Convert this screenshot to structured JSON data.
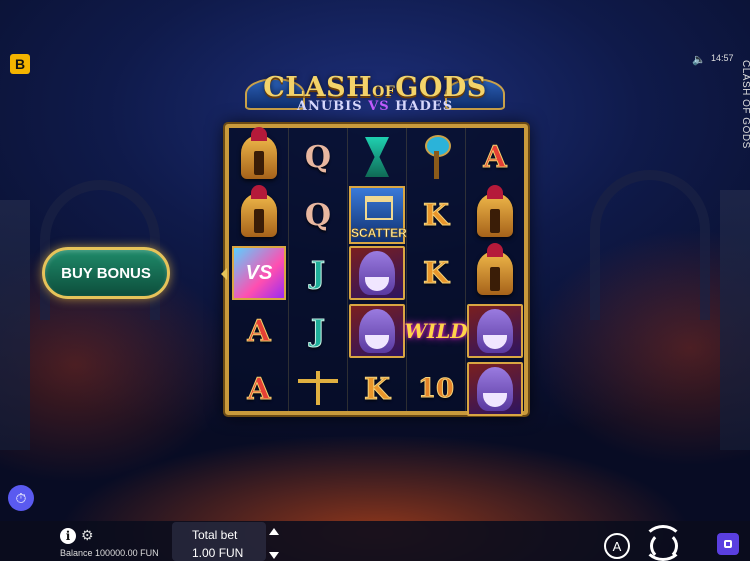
{
  "brand": {
    "badge_letter": "B"
  },
  "status": {
    "time": "14:57",
    "vertical_title": "CLASH OF GODS"
  },
  "logo": {
    "main_a": "CLASH",
    "main_of": "OF",
    "main_b": "GODS",
    "sub_a": "ANUBIS",
    "sub_vs": "VS",
    "sub_b": "HADES"
  },
  "reels": {
    "grid": [
      [
        "helmet",
        "Q",
        "hourglass",
        "axe",
        "A"
      ],
      [
        "helmet",
        "Q",
        "scatter",
        "K",
        "helmet"
      ],
      [
        "vs",
        "J",
        "hades",
        "K",
        "helmet"
      ],
      [
        "A",
        "J",
        "hades",
        "wild",
        "hades"
      ],
      [
        "A",
        "scales",
        "K",
        "10",
        "hades"
      ]
    ],
    "symbol_labels": {
      "scatter": "SCATTER",
      "wild": "WILD",
      "vs": "VS"
    }
  },
  "controls": {
    "buy_bonus": "BUY BONUS",
    "balance_label": "Balance",
    "balance_value": "100000.00",
    "balance_currency": "FUN",
    "total_bet_label": "Total bet",
    "total_bet_value": "1.00 FUN",
    "auto_label": "A",
    "info_label": "i"
  },
  "icons": {
    "sound": "speaker-icon",
    "gear": "gear-icon",
    "history": "history-icon",
    "spin": "spin-icon",
    "menu": "menu-icon"
  }
}
